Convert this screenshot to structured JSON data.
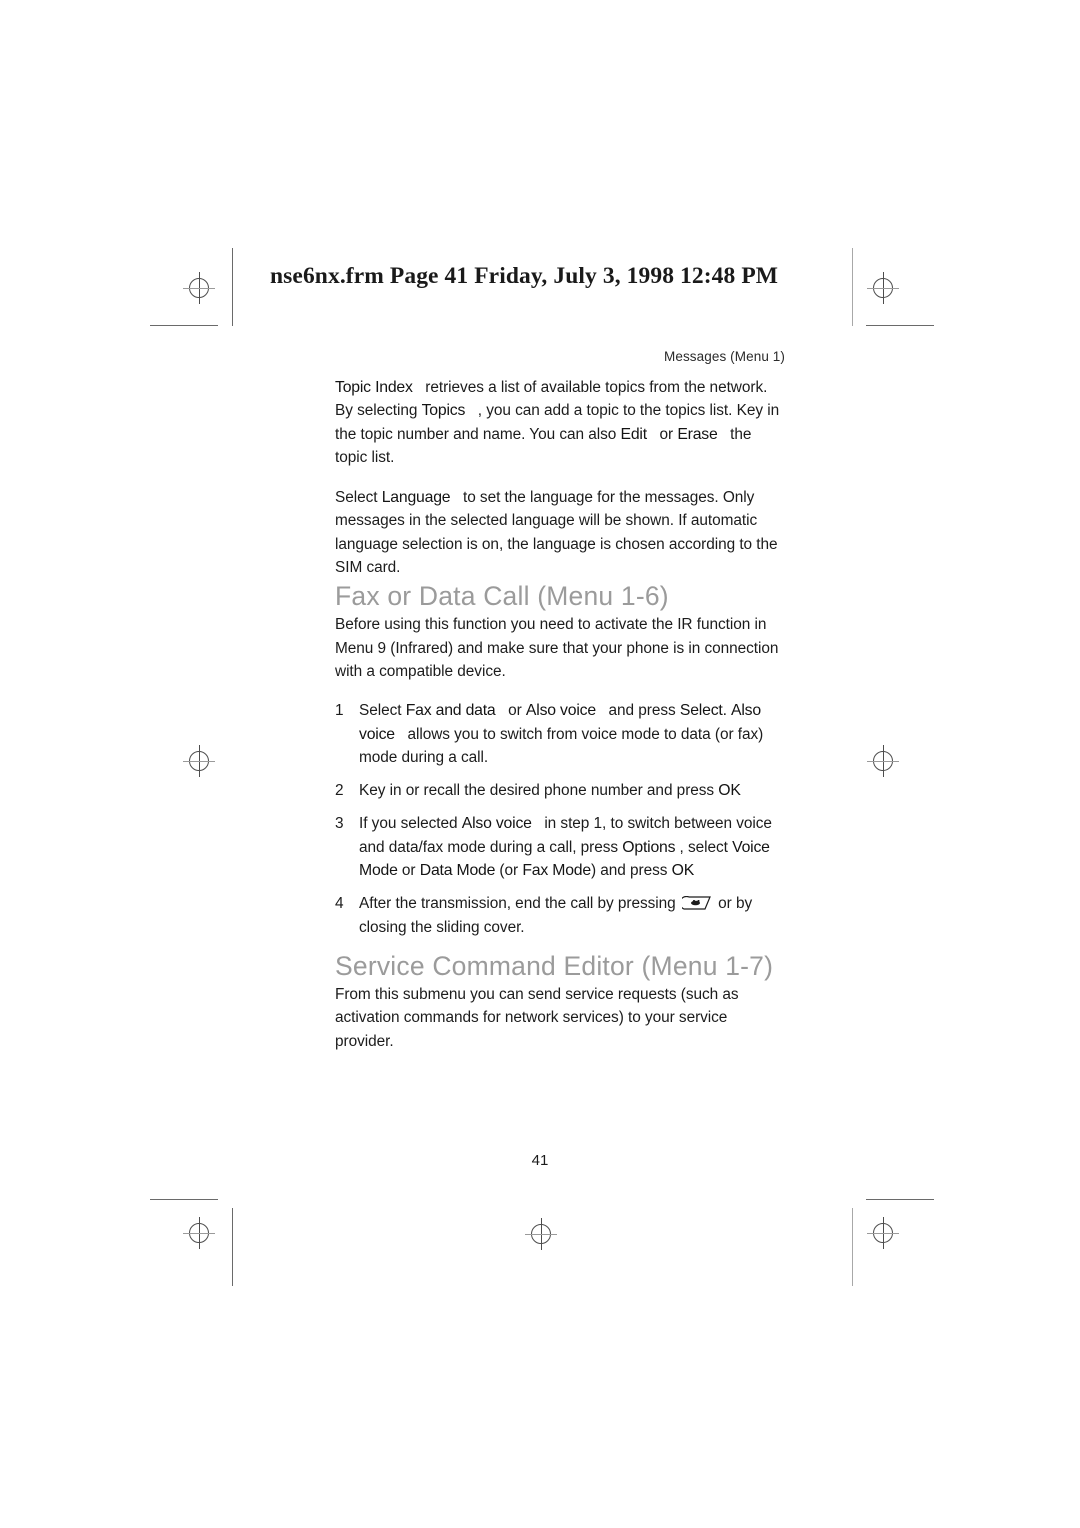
{
  "print_marks": {
    "registration_icon": "registration-target-icon",
    "trim_line": "trim-line"
  },
  "frm_header": {
    "text": "nse6nx.frm  Page 41  Friday, July 3, 1998  12:48 PM"
  },
  "running_head": {
    "text": "Messages (Menu 1)"
  },
  "body": {
    "para_topic_index": {
      "term1": "Topic Index",
      "run1": "retrieves a list of available topics from the network. By selecting ",
      "term2": "Topics",
      "run2": ", you can add a topic to the topics list. Key in the topic number and name. You can also ",
      "term3": "Edit",
      "run3": "or ",
      "term4": "Erase",
      "run4": "the topic list."
    },
    "para_language": {
      "run1": "Select ",
      "term1": "Language",
      "run2": "to set the language for the messages. Only messages in the selected language will be shown. If automatic language selection is on, the language is chosen according to the SIM card."
    }
  },
  "section_fax": {
    "heading": "Fax or Data Call (Menu 1-6)",
    "intro": "Before using this function you need to activate the IR function in Menu 9 (Infrared) and make sure that your phone is in connection with a compatible device.",
    "steps": [
      {
        "num": "1",
        "run1": "Select ",
        "term1": "Fax and data",
        "run2": "or ",
        "term2": "Also voice",
        "run3": "and press ",
        "term3": "Select.",
        "term4": "Also voice",
        "run4": "allows you to switch from voice mode to data (or fax) mode during a call."
      },
      {
        "num": "2",
        "run1": "Key in or recall the desired phone number and press ",
        "term1": "OK"
      },
      {
        "num": "3",
        "run1": "If you selected ",
        "term1": "Also voice",
        "run2": "in step 1, to switch between voice and data/fax mode during a call, press ",
        "term2": "Options",
        "run3": ", select ",
        "term3": "Voice Mode",
        "run4": "or ",
        "term4": "Data Mode",
        "run5": "(or ",
        "term5": "Fax Mode",
        "run6": ") and press ",
        "term6": "OK"
      },
      {
        "num": "4",
        "run1": "After the transmission, end the call by pressing ",
        "icon": "end-call-key-icon",
        "run2": " or by closing the sliding cover."
      }
    ]
  },
  "section_service": {
    "heading": "Service Command Editor (Menu 1-7)",
    "intro": "From this submenu you can send service requests (such as activation commands for network services) to your service provider."
  },
  "page_number": "41",
  "colors": {
    "heading_gray": "#9b9b9b",
    "body_text": "#1c1c1c",
    "mark_gray": "#4d4d4d"
  }
}
